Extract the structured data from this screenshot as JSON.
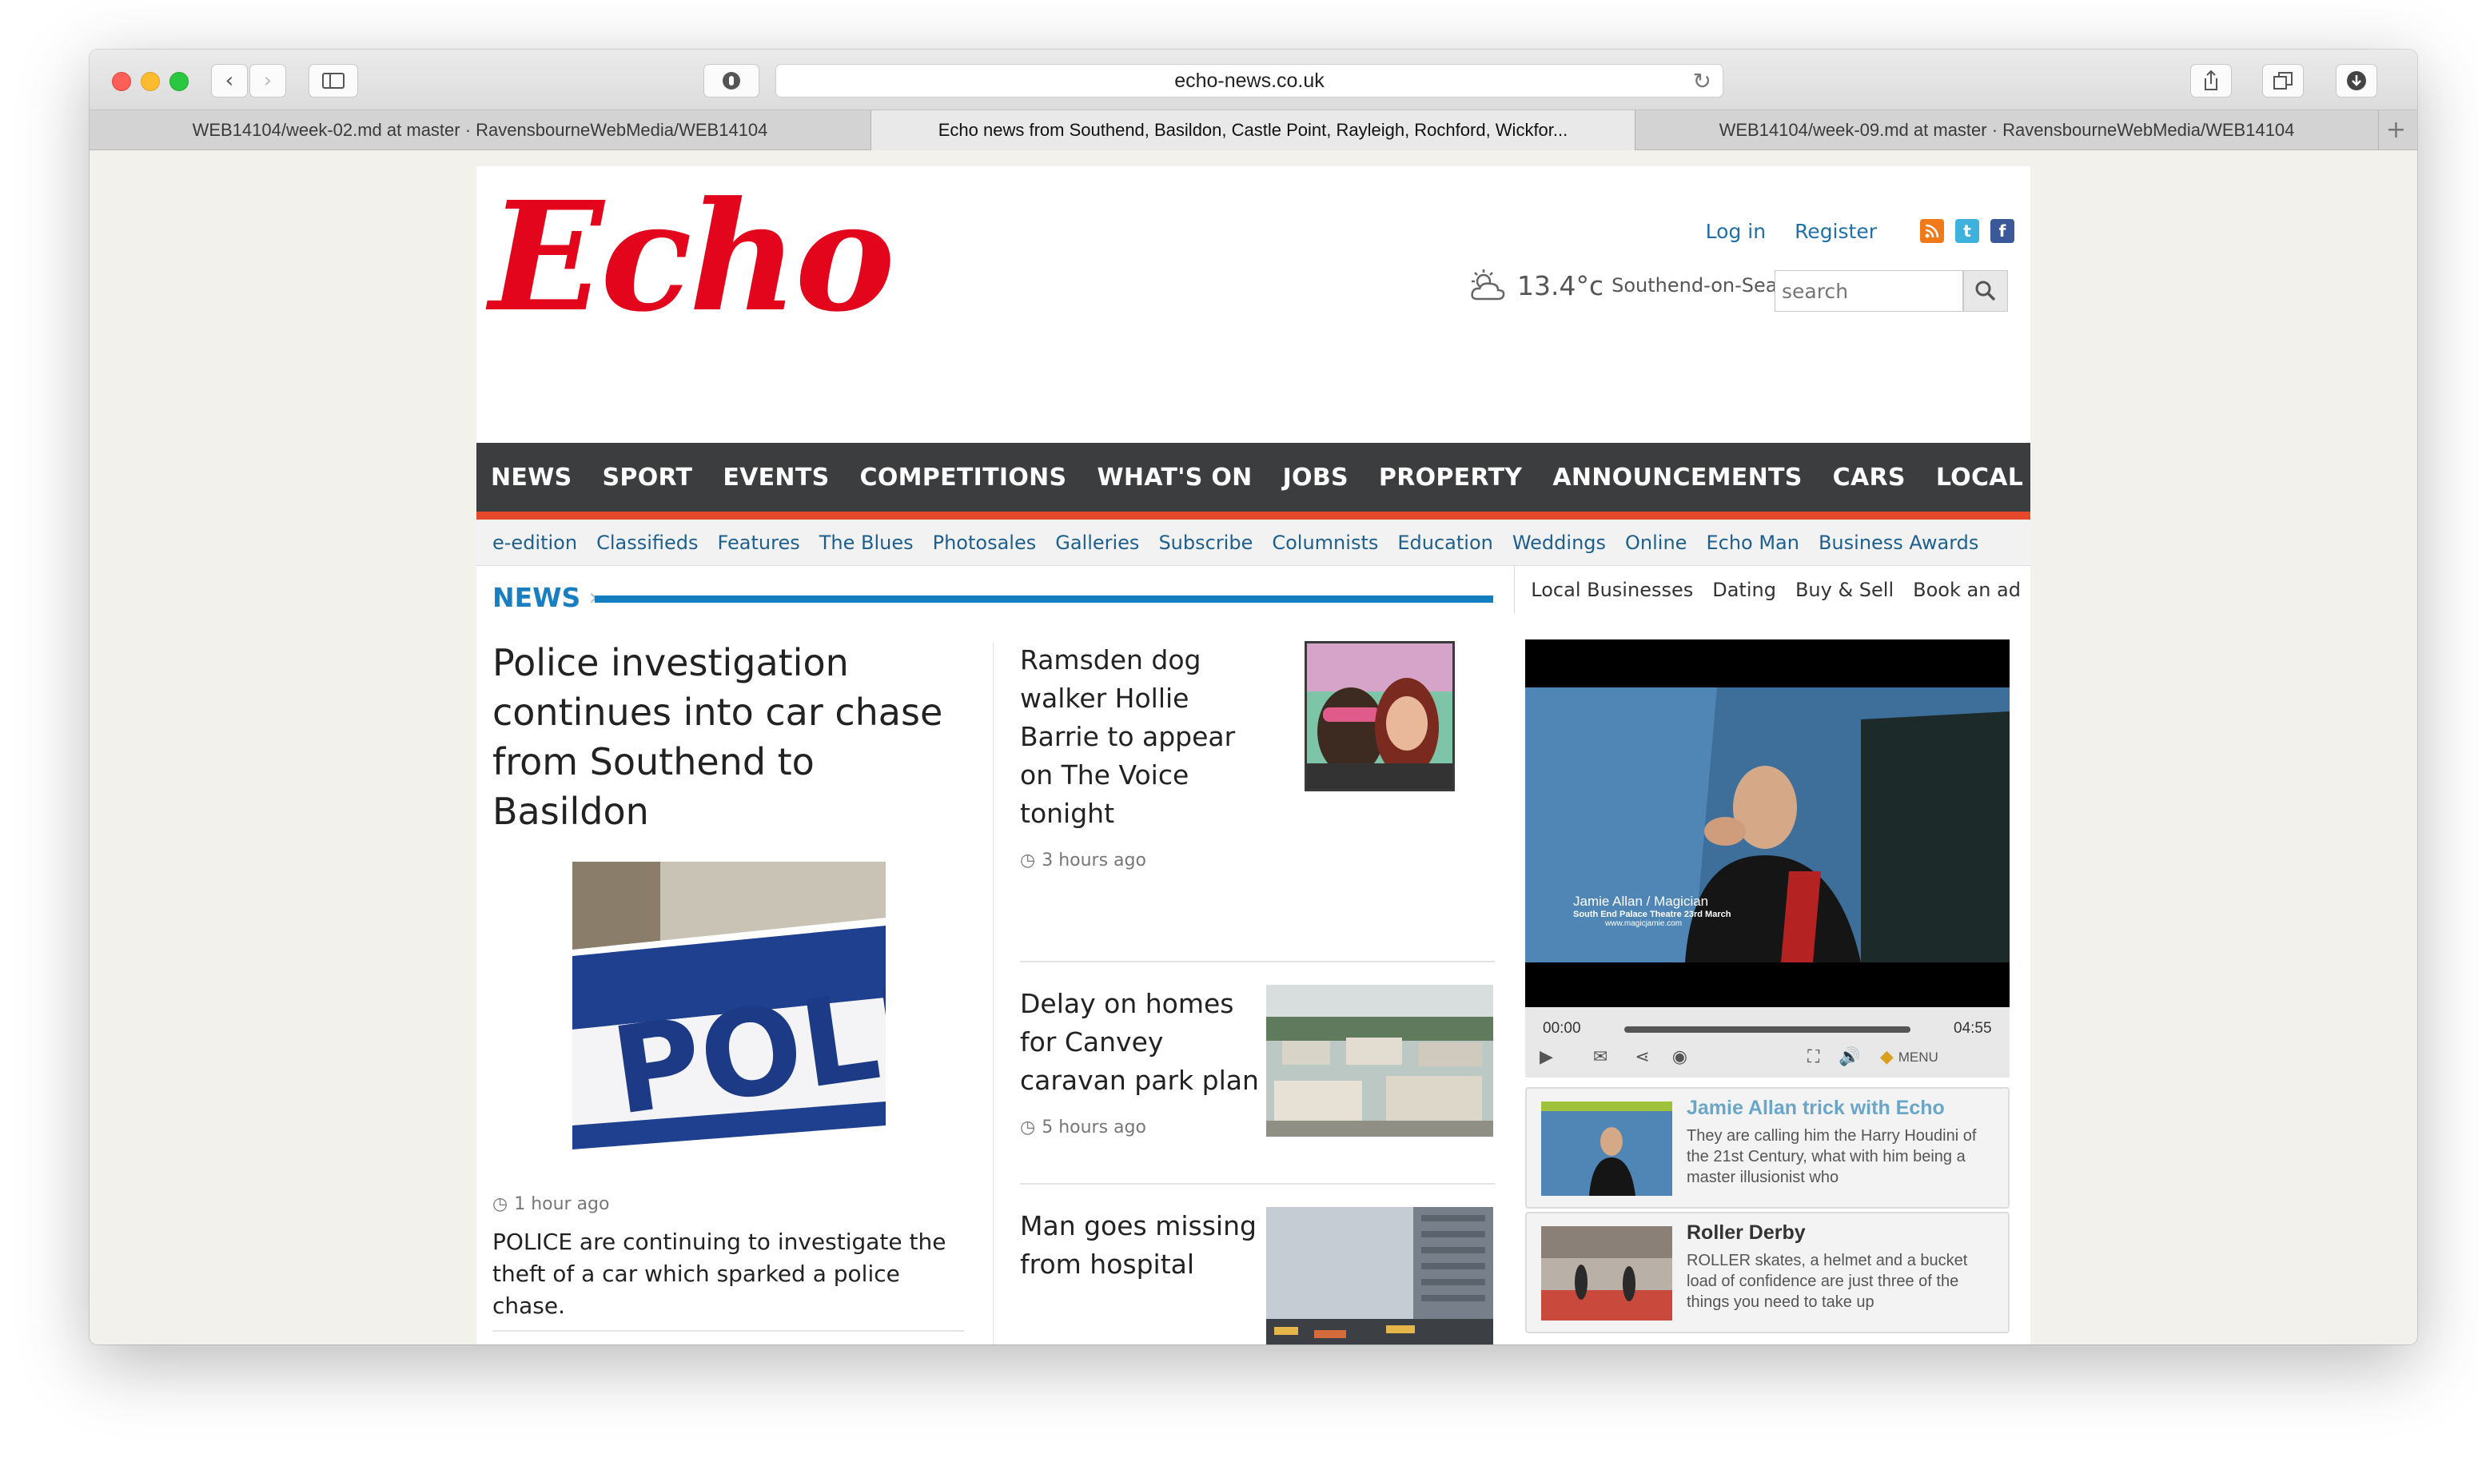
{
  "browser": {
    "url": "echo-news.co.uk",
    "tabs": [
      {
        "label": "WEB14104/week-02.md at master · RavensbourneWebMedia/WEB14104",
        "active": false
      },
      {
        "label": "Echo news from Southend, Basildon, Castle Point, Rayleigh, Rochford, Wickfor...",
        "active": true
      },
      {
        "label": "WEB14104/week-09.md at master · RavensbourneWebMedia/WEB14104",
        "active": false
      }
    ]
  },
  "header": {
    "logo": "Echo",
    "login": "Log in",
    "register": "Register",
    "weather_temp": "13.4°c",
    "weather_place": "Southend-on-Sea",
    "search_placeholder": "search",
    "social_icons": [
      "rss-icon",
      "twitter-icon",
      "facebook-icon"
    ]
  },
  "main_nav": [
    "NEWS",
    "SPORT",
    "EVENTS",
    "COMPETITIONS",
    "WHAT'S ON",
    "JOBS",
    "PROPERTY",
    "ANNOUNCEMENTS",
    "CARS",
    "LOCAL INFO"
  ],
  "sub_nav": [
    "e-edition",
    "Classifieds",
    "Features",
    "The Blues",
    "Photosales",
    "Galleries",
    "Subscribe",
    "Columnists",
    "Education",
    "Weddings",
    "Online",
    "Echo Man",
    "Business Awards"
  ],
  "sub_nav2": [
    "Local Businesses",
    "Dating",
    "Buy & Sell",
    "Book an ad"
  ],
  "section": {
    "title": "NEWS"
  },
  "lead_story": {
    "title": "Police investigation continues into car chase from Southend to Basildon",
    "time": "1 hour ago",
    "summary": "POLICE are continuing to investigate the theft of a car which sparked a police chase."
  },
  "stories": [
    {
      "title": "Ramsden dog walker Hollie Barrie to appear on The Voice tonight",
      "time": "3 hours ago"
    },
    {
      "title": "Delay on homes for Canvey caravan park plan",
      "time": "5 hours ago"
    },
    {
      "title": "Man goes missing from hospital",
      "time": ""
    }
  ],
  "video": {
    "caption_name": "Jamie Allan / Magician",
    "caption_venue": "South End Palace Theatre 23rd March",
    "caption_url": "www.magicjamie.com",
    "current_time": "00:00",
    "duration": "04:55",
    "menu_label": "MENU"
  },
  "playlist": [
    {
      "title": "Jamie Allan trick with Echo",
      "desc": "They are calling him the Harry Houdini of the 21st Century, what with him being a master illusionist who",
      "title_color": "#6aa6c8"
    },
    {
      "title": "Roller Derby",
      "desc": "ROLLER skates, a helmet and a bucket load of confidence are just three of the things you need to take up",
      "title_color": "#333333"
    }
  ],
  "colors": {
    "brand_red": "#e3051b",
    "nav_bg": "#3b3d3f",
    "nav_accent": "#e5482b",
    "link_blue": "#1d5f8e",
    "section_blue": "#137ebf"
  }
}
